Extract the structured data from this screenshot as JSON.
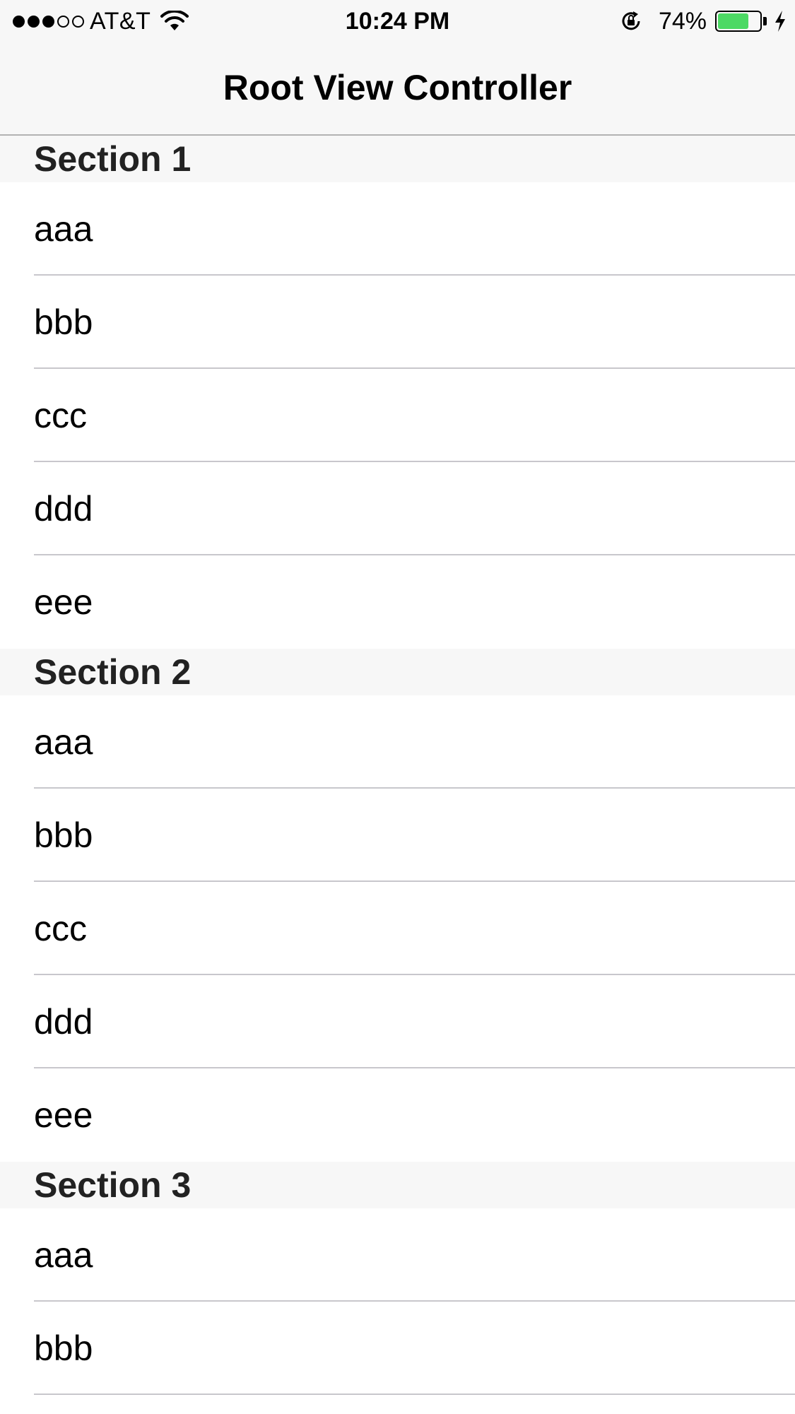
{
  "status_bar": {
    "signal_full": 3,
    "signal_empty": 2,
    "carrier": "AT&T",
    "time": "10:24 PM",
    "battery_percent_label": "74%",
    "battery_level": 0.74,
    "battery_color": "#4cd964",
    "icons": [
      "signal-dots-icon",
      "wifi-icon",
      "rotation-lock-icon",
      "battery-icon",
      "charging-bolt-icon"
    ]
  },
  "nav_bar": {
    "title": "Root View Controller"
  },
  "table": {
    "sections": [
      {
        "title": "Section 1",
        "rows": [
          "aaa",
          "bbb",
          "ccc",
          "ddd",
          "eee"
        ]
      },
      {
        "title": "Section 2",
        "rows": [
          "aaa",
          "bbb",
          "ccc",
          "ddd",
          "eee"
        ]
      },
      {
        "title": "Section 3",
        "rows": [
          "aaa",
          "bbb"
        ]
      }
    ]
  },
  "colors": {
    "bar_background": "#f7f7f7",
    "separator": "#c8c7cc",
    "section_header_background": "#f7f7f7"
  }
}
